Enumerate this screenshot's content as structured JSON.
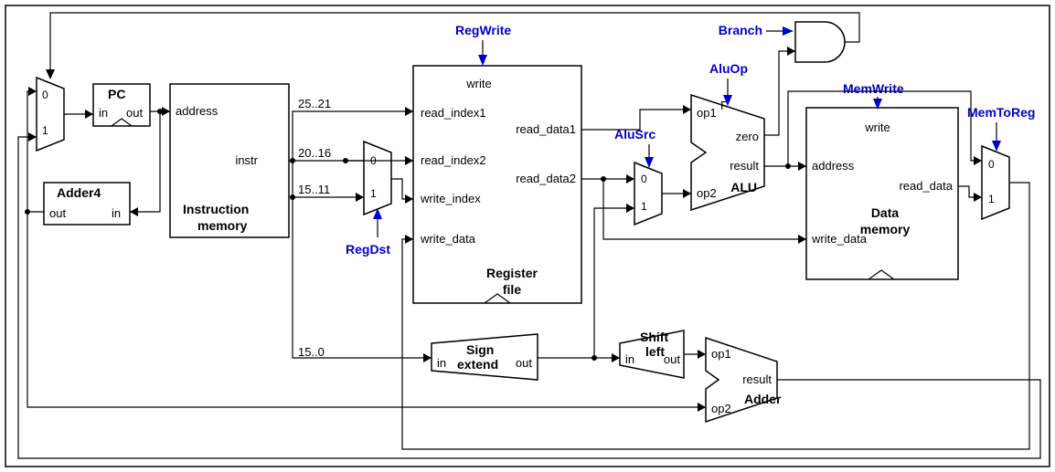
{
  "control_signals": {
    "RegWrite": "RegWrite",
    "Branch": "Branch",
    "AluOp": "AluOp",
    "AluSrc": "AluSrc",
    "RegDst": "RegDst",
    "MemWrite": "MemWrite",
    "MemToReg": "MemToReg"
  },
  "blocks": {
    "pc": {
      "name": "PC",
      "ports": {
        "in": "in",
        "out": "out"
      }
    },
    "adder4": {
      "name": "Adder4",
      "ports": {
        "in": "in",
        "out": "out"
      }
    },
    "instr_mem": {
      "name": "Instruction memory",
      "ports": {
        "address": "address",
        "instr": "instr"
      }
    },
    "reg_file": {
      "name": "Register file",
      "ports": {
        "write": "write",
        "read_index1": "read_index1",
        "read_index2": "read_index2",
        "write_index": "write_index",
        "write_data": "write_data",
        "read_data1": "read_data1",
        "read_data2": "read_data2"
      }
    },
    "alu": {
      "name": "ALU",
      "ports": {
        "op1": "op1",
        "op2": "op2",
        "F": "F",
        "zero": "zero",
        "result": "result"
      }
    },
    "data_mem": {
      "name": "Data memory",
      "ports": {
        "write": "write",
        "address": "address",
        "read_data": "read_data",
        "write_data": "write_data"
      }
    },
    "sign_extend": {
      "name": "Sign extend",
      "ports": {
        "in": "in",
        "out": "out"
      }
    },
    "shift_left": {
      "name": "Shift left",
      "ports": {
        "in": "in",
        "out": "out"
      }
    },
    "branch_adder": {
      "name": "Adder",
      "ports": {
        "op1": "op1",
        "op2": "op2",
        "result": "result"
      }
    }
  },
  "bitfields": {
    "rs": "25..21",
    "rt": "20..16",
    "rd": "15..11",
    "imm": "15..0"
  },
  "mux": {
    "zero": "0",
    "one": "1"
  }
}
